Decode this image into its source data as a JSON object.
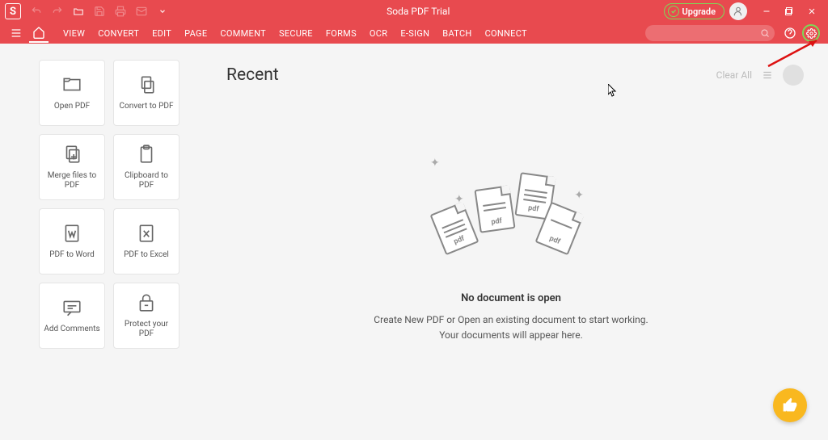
{
  "titleBar": {
    "logo": "S",
    "title": "Soda PDF Trial",
    "upgrade": "Upgrade"
  },
  "menu": {
    "items": [
      "VIEW",
      "CONVERT",
      "EDIT",
      "PAGE",
      "COMMENT",
      "SECURE",
      "FORMS",
      "OCR",
      "E-SIGN",
      "BATCH",
      "CONNECT"
    ]
  },
  "actions": [
    {
      "id": "open-pdf",
      "label": "Open PDF"
    },
    {
      "id": "convert-to-pdf",
      "label": "Convert to PDF"
    },
    {
      "id": "merge-files",
      "label": "Merge files to PDF"
    },
    {
      "id": "clipboard-to-pdf",
      "label": "Clipboard to PDF"
    },
    {
      "id": "pdf-to-word",
      "label": "PDF to Word"
    },
    {
      "id": "pdf-to-excel",
      "label": "PDF to Excel"
    },
    {
      "id": "add-comments",
      "label": "Add Comments"
    },
    {
      "id": "protect-pdf",
      "label": "Protect your PDF"
    }
  ],
  "recent": {
    "title": "Recent",
    "clearAll": "Clear All",
    "emptyTitle": "No document is open",
    "emptyLine1": "Create New PDF or Open an existing document to start working.",
    "emptyLine2": "Your documents will appear here.",
    "docLabel": "pdf"
  }
}
